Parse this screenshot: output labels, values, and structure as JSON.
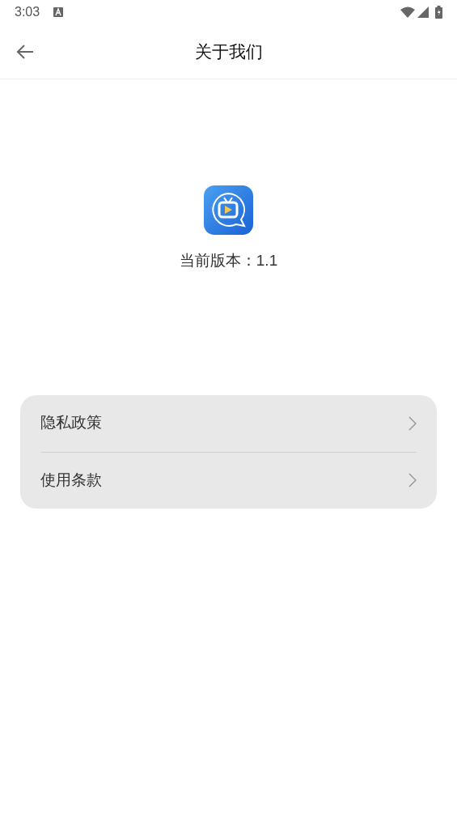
{
  "status_bar": {
    "time": "3:03"
  },
  "header": {
    "title": "关于我们"
  },
  "app": {
    "version_text": "当前版本：1.1"
  },
  "menu": [
    {
      "label": "隐私政策"
    },
    {
      "label": "使用条款"
    }
  ]
}
